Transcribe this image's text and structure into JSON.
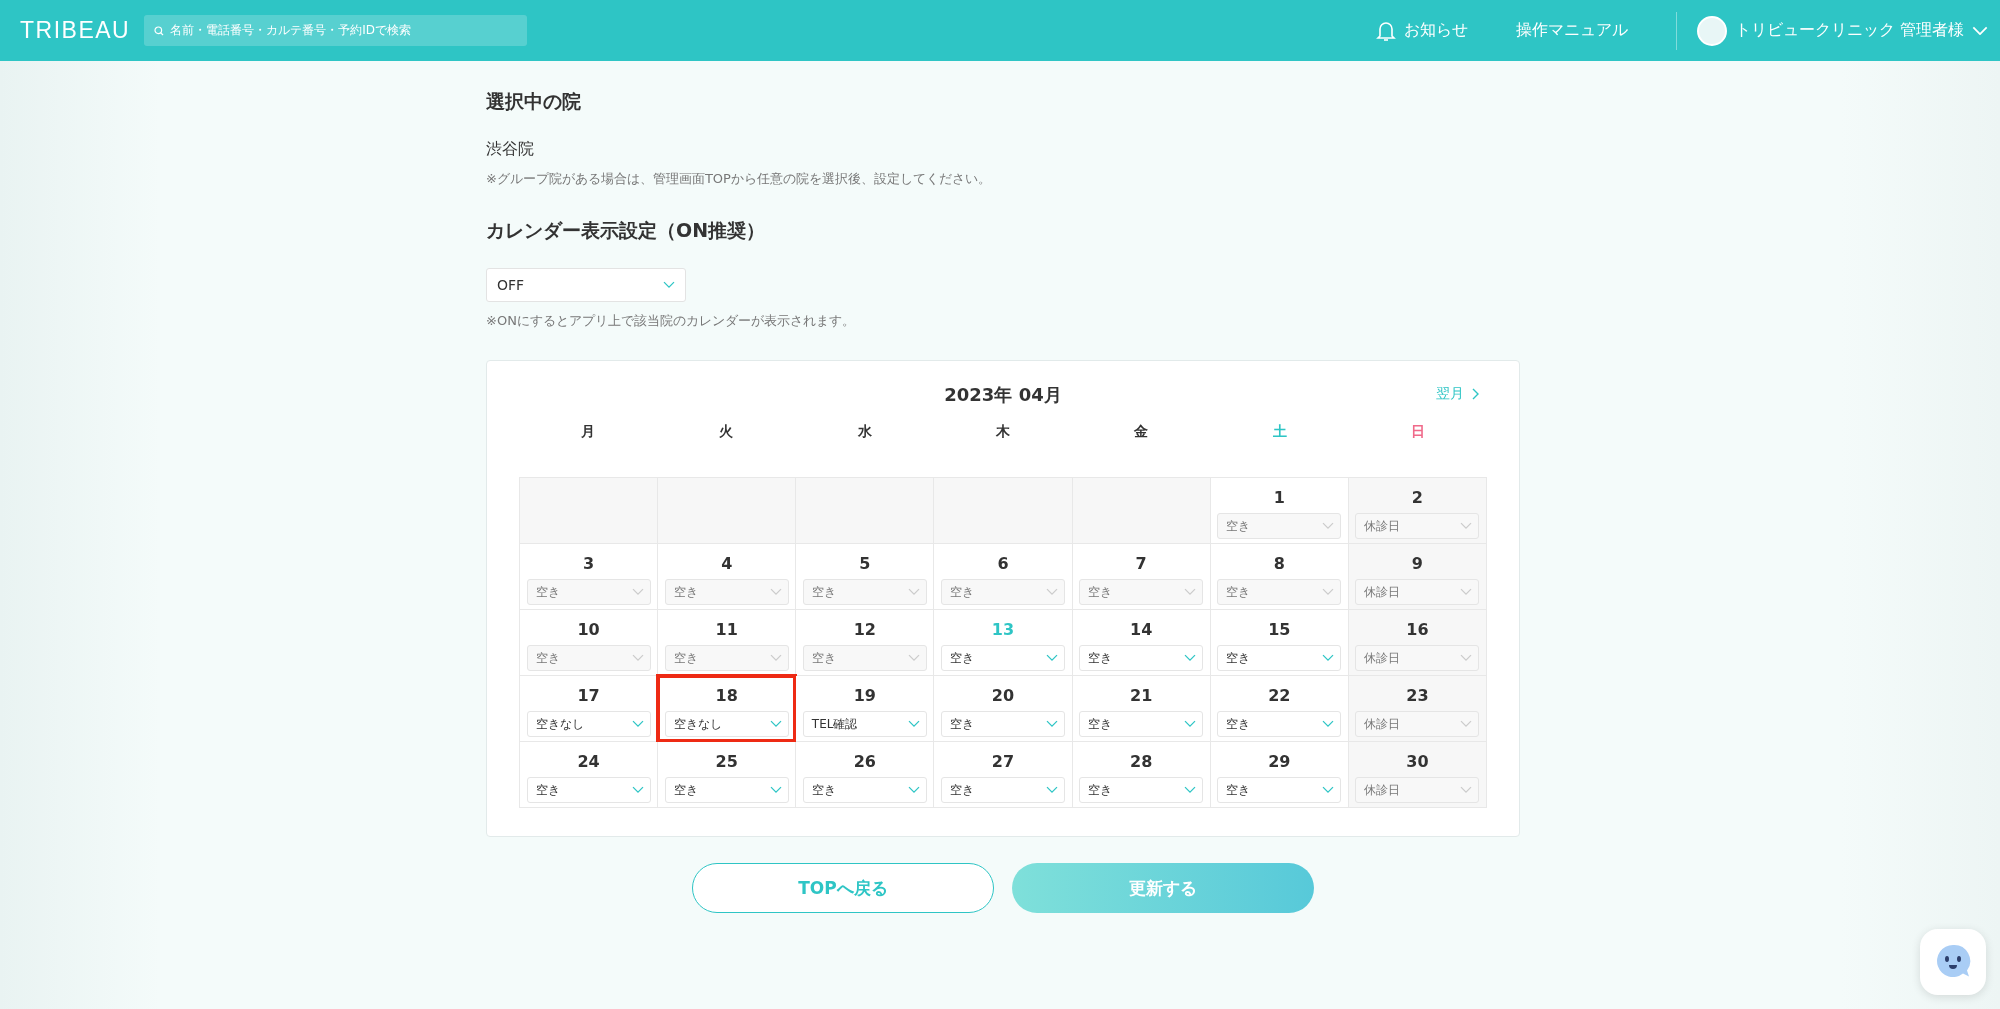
{
  "header": {
    "logo": "TRIBEAU",
    "search_placeholder": "名前・電話番号・カルテ番号・予約IDで検索",
    "notice": "お知らせ",
    "manual": "操作マニュアル",
    "user": "トリビュークリニック 管理者様"
  },
  "clinic": {
    "heading": "選択中の院",
    "name": "渋谷院",
    "note": "※グループ院がある場合は、管理画面TOPから任意の院を選択後、設定してください。"
  },
  "calendar_setting": {
    "heading": "カレンダー表示設定（ON推奨）",
    "value": "OFF",
    "note": "※ONにするとアプリ上で該当院のカレンダーが表示されます。"
  },
  "calendar": {
    "title": "2023年 04月",
    "next": "翌月",
    "weekdays": [
      {
        "label": "月",
        "color": "#333333"
      },
      {
        "label": "火",
        "color": "#333333"
      },
      {
        "label": "水",
        "color": "#333333"
      },
      {
        "label": "木",
        "color": "#333333"
      },
      {
        "label": "金",
        "color": "#333333"
      },
      {
        "label": "土",
        "color": "#2ec5c5"
      },
      {
        "label": "日",
        "color": "#f06a8a"
      }
    ],
    "cells": [
      {
        "kind": "blank"
      },
      {
        "kind": "blank"
      },
      {
        "kind": "blank"
      },
      {
        "kind": "blank"
      },
      {
        "kind": "blank"
      },
      {
        "kind": "day",
        "day": "1",
        "value": "空き",
        "disabled": true,
        "closed": false,
        "today": false,
        "highlighted": false
      },
      {
        "kind": "day",
        "day": "2",
        "value": "休診日",
        "disabled": true,
        "closed": true,
        "today": false,
        "highlighted": false
      },
      {
        "kind": "day",
        "day": "3",
        "value": "空き",
        "disabled": true,
        "closed": false,
        "today": false,
        "highlighted": false
      },
      {
        "kind": "day",
        "day": "4",
        "value": "空き",
        "disabled": true,
        "closed": false,
        "today": false,
        "highlighted": false
      },
      {
        "kind": "day",
        "day": "5",
        "value": "空き",
        "disabled": true,
        "closed": false,
        "today": false,
        "highlighted": false
      },
      {
        "kind": "day",
        "day": "6",
        "value": "空き",
        "disabled": true,
        "closed": false,
        "today": false,
        "highlighted": false
      },
      {
        "kind": "day",
        "day": "7",
        "value": "空き",
        "disabled": true,
        "closed": false,
        "today": false,
        "highlighted": false
      },
      {
        "kind": "day",
        "day": "8",
        "value": "空き",
        "disabled": true,
        "closed": false,
        "today": false,
        "highlighted": false
      },
      {
        "kind": "day",
        "day": "9",
        "value": "休診日",
        "disabled": true,
        "closed": true,
        "today": false,
        "highlighted": false
      },
      {
        "kind": "day",
        "day": "10",
        "value": "空き",
        "disabled": true,
        "closed": false,
        "today": false,
        "highlighted": false
      },
      {
        "kind": "day",
        "day": "11",
        "value": "空き",
        "disabled": true,
        "closed": false,
        "today": false,
        "highlighted": false
      },
      {
        "kind": "day",
        "day": "12",
        "value": "空き",
        "disabled": true,
        "closed": false,
        "today": false,
        "highlighted": false
      },
      {
        "kind": "day",
        "day": "13",
        "value": "空き",
        "disabled": false,
        "closed": false,
        "today": true,
        "highlighted": false
      },
      {
        "kind": "day",
        "day": "14",
        "value": "空き",
        "disabled": false,
        "closed": false,
        "today": false,
        "highlighted": false
      },
      {
        "kind": "day",
        "day": "15",
        "value": "空き",
        "disabled": false,
        "closed": false,
        "today": false,
        "highlighted": false
      },
      {
        "kind": "day",
        "day": "16",
        "value": "休診日",
        "disabled": true,
        "closed": true,
        "today": false,
        "highlighted": false
      },
      {
        "kind": "day",
        "day": "17",
        "value": "空きなし",
        "disabled": false,
        "closed": false,
        "today": false,
        "highlighted": false
      },
      {
        "kind": "day",
        "day": "18",
        "value": "空きなし",
        "disabled": false,
        "closed": false,
        "today": false,
        "highlighted": true
      },
      {
        "kind": "day",
        "day": "19",
        "value": "TEL確認",
        "disabled": false,
        "closed": false,
        "today": false,
        "highlighted": false
      },
      {
        "kind": "day",
        "day": "20",
        "value": "空き",
        "disabled": false,
        "closed": false,
        "today": false,
        "highlighted": false
      },
      {
        "kind": "day",
        "day": "21",
        "value": "空き",
        "disabled": false,
        "closed": false,
        "today": false,
        "highlighted": false
      },
      {
        "kind": "day",
        "day": "22",
        "value": "空き",
        "disabled": false,
        "closed": false,
        "today": false,
        "highlighted": false
      },
      {
        "kind": "day",
        "day": "23",
        "value": "休診日",
        "disabled": true,
        "closed": true,
        "today": false,
        "highlighted": false
      },
      {
        "kind": "day",
        "day": "24",
        "value": "空き",
        "disabled": false,
        "closed": false,
        "today": false,
        "highlighted": false
      },
      {
        "kind": "day",
        "day": "25",
        "value": "空き",
        "disabled": false,
        "closed": false,
        "today": false,
        "highlighted": false
      },
      {
        "kind": "day",
        "day": "26",
        "value": "空き",
        "disabled": false,
        "closed": false,
        "today": false,
        "highlighted": false
      },
      {
        "kind": "day",
        "day": "27",
        "value": "空き",
        "disabled": false,
        "closed": false,
        "today": false,
        "highlighted": false
      },
      {
        "kind": "day",
        "day": "28",
        "value": "空き",
        "disabled": false,
        "closed": false,
        "today": false,
        "highlighted": false
      },
      {
        "kind": "day",
        "day": "29",
        "value": "空き",
        "disabled": false,
        "closed": false,
        "today": false,
        "highlighted": false
      },
      {
        "kind": "day",
        "day": "30",
        "value": "休診日",
        "disabled": true,
        "closed": true,
        "today": false,
        "highlighted": false
      }
    ]
  },
  "buttons": [
    {
      "label": "TOPへ戻る",
      "kind": "outline"
    },
    {
      "label": "更新する",
      "kind": "primary"
    }
  ]
}
